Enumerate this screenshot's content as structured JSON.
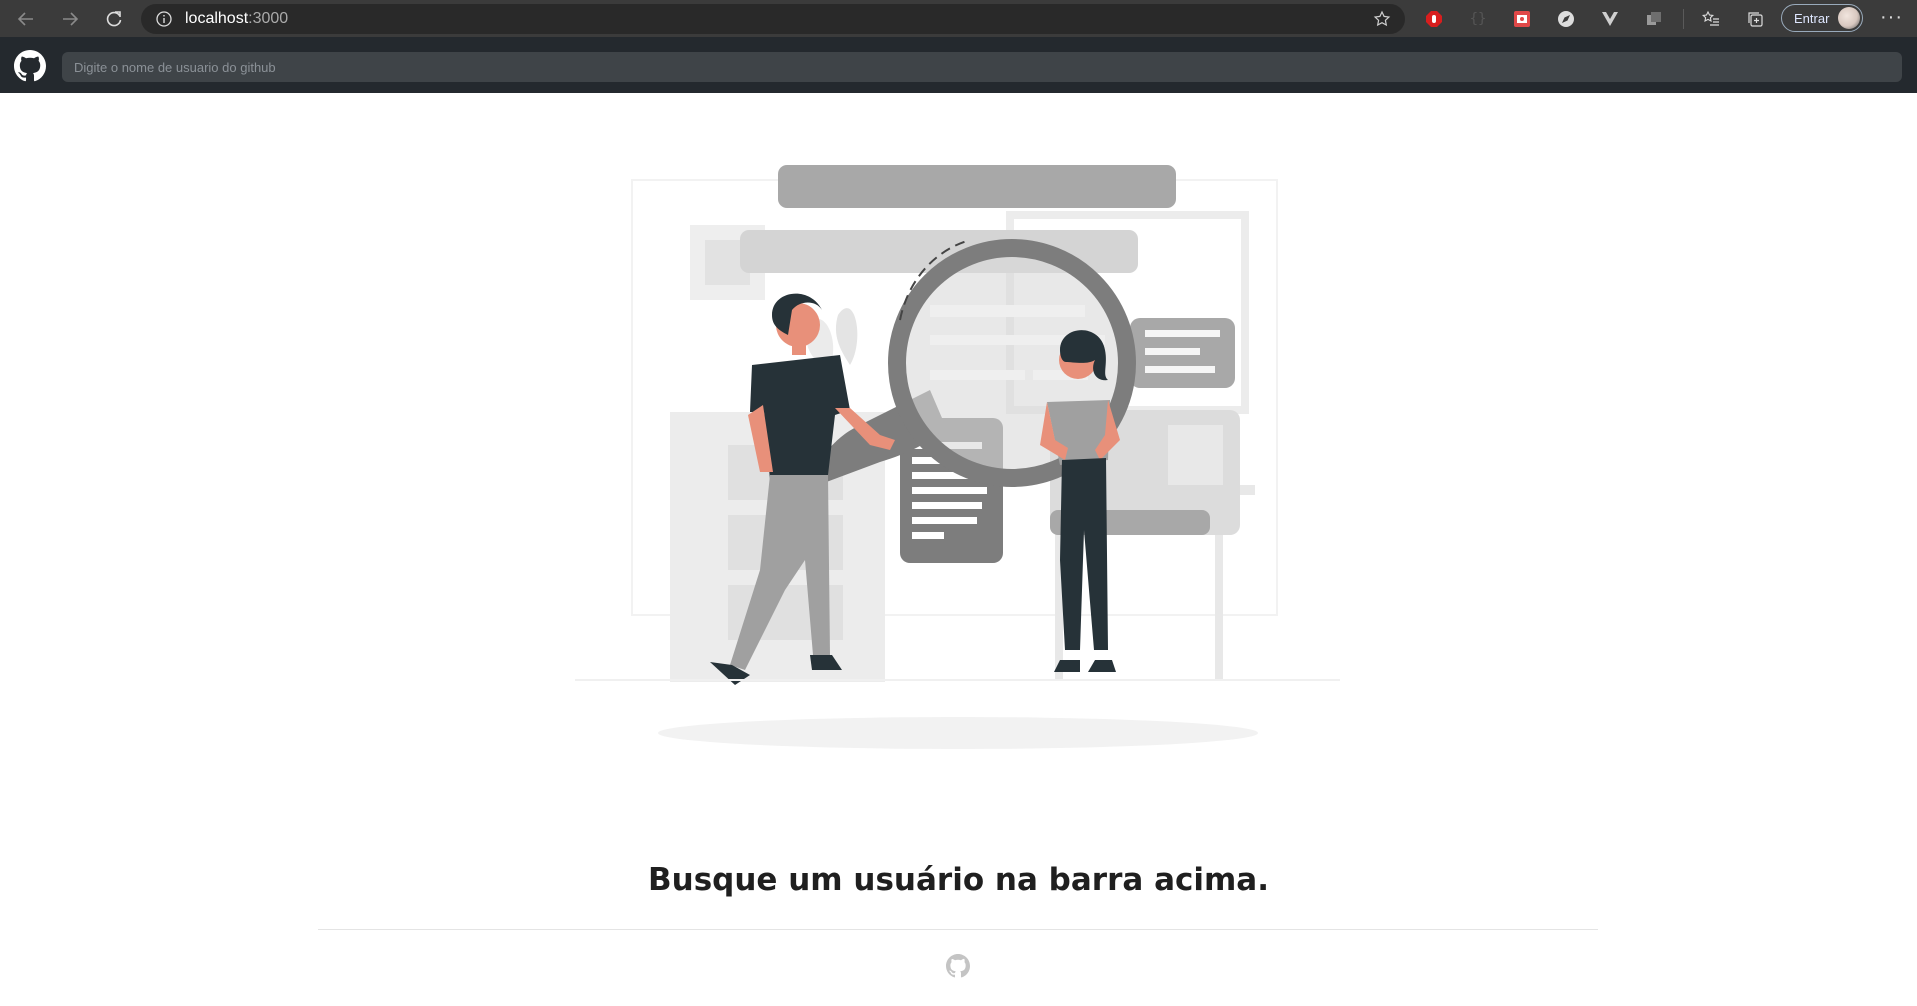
{
  "browser": {
    "url_host": "localhost",
    "url_port": ":3000",
    "signin_label": "Entrar",
    "icons": [
      "back-icon",
      "forward-icon",
      "refresh-icon",
      "info-icon",
      "star-icon",
      "adblock-icon",
      "json-icon",
      "screenshot-icon",
      "compass-icon",
      "vue-devtools-icon",
      "extensions-icon",
      "favorites-icon",
      "collections-icon",
      "more-icon"
    ],
    "more_label": "···"
  },
  "header": {
    "search_placeholder": "Digite o nome de usuario do github"
  },
  "main": {
    "message": "Busque um usuário na barra acima."
  },
  "colors": {
    "header_bg": "#24292e",
    "browser_bg": "#3b3b3b",
    "text": "#1f1f1f"
  }
}
